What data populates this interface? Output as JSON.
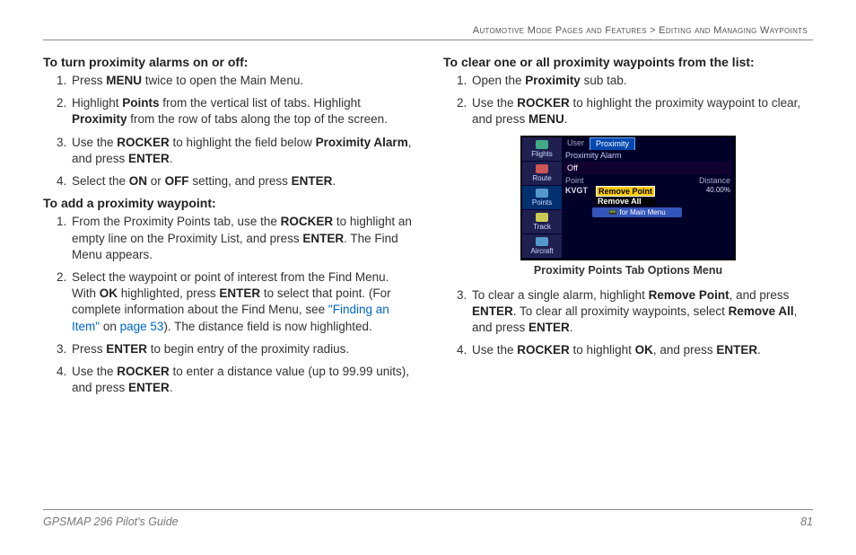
{
  "breadcrumb": {
    "left": "Automotive Mode Pages and Features",
    "sep": ">",
    "right": "Editing and Managing Waypoints"
  },
  "left": {
    "h1": "To turn proximity alarms on or off:",
    "s1": {
      "i1a": "Press ",
      "i1b": "MENU",
      "i1c": " twice to open the Main Menu.",
      "i2a": "Highlight ",
      "i2b": "Points",
      "i2c": " from the vertical list of tabs. Highlight ",
      "i2d": "Proximity",
      "i2e": " from the row of tabs along the top of the screen.",
      "i3a": "Use the ",
      "i3b": "ROCKER",
      "i3c": " to highlight the field below ",
      "i3d": "Proximity Alarm",
      "i3e": ", and press ",
      "i3f": "ENTER",
      "i3g": ".",
      "i4a": "Select the ",
      "i4b": "ON",
      "i4c": " or ",
      "i4d": "OFF",
      "i4e": " setting, and press ",
      "i4f": "ENTER",
      "i4g": "."
    },
    "h2": "To add a proximity waypoint:",
    "s2": {
      "i1a": "From the Proximity Points tab, use the ",
      "i1b": "ROCKER",
      "i1c": " to highlight an empty line on the Proximity List, and press ",
      "i1d": "ENTER",
      "i1e": ". The Find Menu appears.",
      "i2a": "Select the waypoint or point of interest from the Find Menu. With ",
      "i2b": "OK",
      "i2c": " highlighted, press ",
      "i2d": "ENTER",
      "i2e": " to select that point. (For complete information about the Find Menu, see ",
      "i2f": "\"Finding an Item\"",
      "i2g": " on ",
      "i2h": "page 53",
      "i2i": "). The distance field is now highlighted.",
      "i3a": "Press ",
      "i3b": "ENTER",
      "i3c": " to begin entry of the proximity radius.",
      "i4a": "Use the ",
      "i4b": "ROCKER",
      "i4c": " to enter a distance value (up to 99.99 units), and press ",
      "i4d": "ENTER",
      "i4e": "."
    }
  },
  "right": {
    "h1": "To clear one or all proximity waypoints from the list:",
    "s1": {
      "i1a": "Open the ",
      "i1b": "Proximity",
      "i1c": " sub tab.",
      "i2a": "Use the ",
      "i2b": "ROCKER",
      "i2c": " to highlight the proximity waypoint to clear, and press ",
      "i2d": "MENU",
      "i2e": "."
    },
    "caption": "Proximity Points Tab Options Menu",
    "s2": {
      "i3a": "To clear a single alarm, highlight ",
      "i3b": "Remove Point",
      "i3c": ", and press ",
      "i3d": "ENTER",
      "i3e": ". To clear all proximity waypoints, select ",
      "i3f": "Remove All",
      "i3g": ", and press ",
      "i3h": "ENTER",
      "i3i": ".",
      "i4a": "Use the ",
      "i4b": "ROCKER",
      "i4c": " to highlight ",
      "i4d": "OK",
      "i4e": ", and press ",
      "i4f": "ENTER",
      "i4g": "."
    }
  },
  "device": {
    "side": [
      "Flights",
      "Route",
      "Points",
      "Track",
      "Aircraft"
    ],
    "tabs": [
      "User",
      "Proximity"
    ],
    "alarmLabel": "Proximity Alarm",
    "alarmValue": "Off",
    "colPoint": "Point",
    "colDist": "Distance",
    "pt": "KVGT",
    "dist": "40.00%",
    "menu1": "Remove Point",
    "menu2": "Remove All",
    "hint": "for Main Menu"
  },
  "footer": {
    "left": "GPSMAP 296 Pilot's Guide",
    "right": "81"
  }
}
